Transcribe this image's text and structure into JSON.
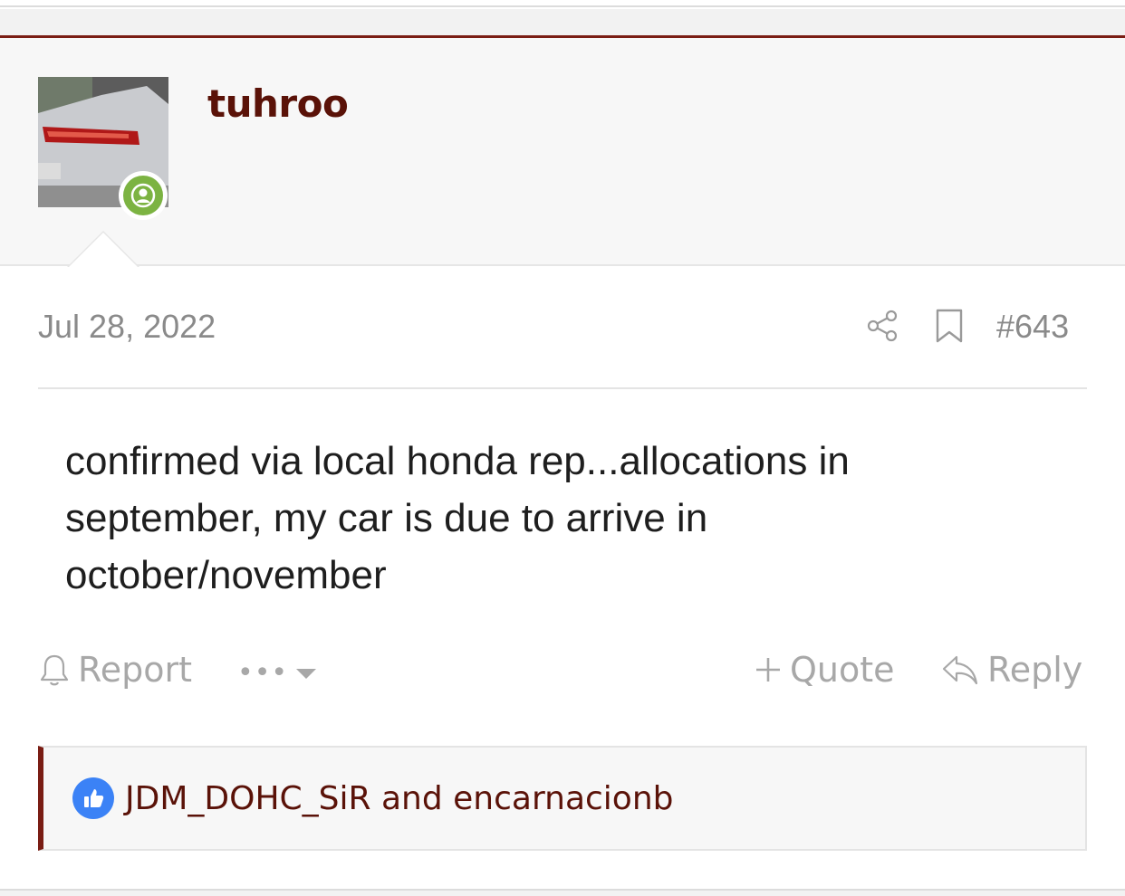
{
  "post": {
    "username": "tuhroo",
    "date": "Jul 28, 2022",
    "number": "#643",
    "body": "confirmed via local honda rep...allocations in september, my car is due to arrive in october/november"
  },
  "actions": {
    "report_label": "Report",
    "more_label": "•••",
    "quote_label": "Quote",
    "reply_label": "Reply"
  },
  "reactions": {
    "text": "JDM_DOHC_SiR and encarnacionb",
    "icon": "thumbs-up-icon"
  },
  "colors": {
    "accent": "#7a1d14",
    "username": "#5a1208",
    "online": "#7cb342",
    "like": "#3b82f6",
    "muted": "#8a8a8a"
  }
}
